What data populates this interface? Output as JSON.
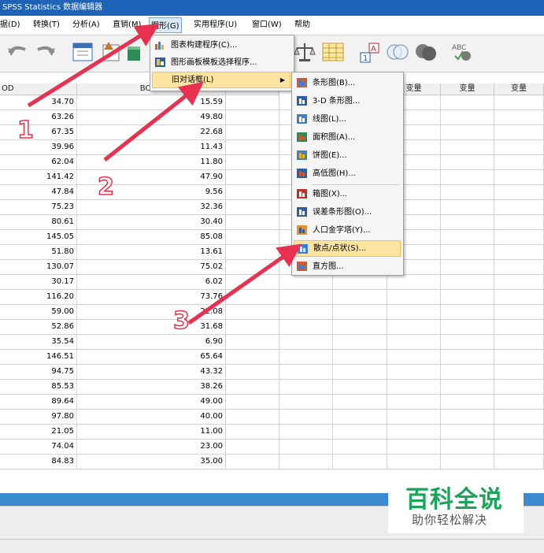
{
  "window": {
    "title": "SPSS Statistics 数据编辑器"
  },
  "menubar": {
    "items": [
      "据(D)",
      "转换(T)",
      "分析(A)",
      "直销(M)",
      "图形(G)",
      "实用程序(U)",
      "窗口(W)",
      "帮助"
    ]
  },
  "grid": {
    "col_headers": [
      "OD",
      "BOD5",
      "变量",
      "变量",
      "变量",
      "变量"
    ],
    "rows": [
      [
        "34.70",
        "15.59"
      ],
      [
        "63.26",
        "49.80"
      ],
      [
        "67.35",
        "22.68"
      ],
      [
        "39.96",
        "11.43"
      ],
      [
        "62.04",
        "11.80"
      ],
      [
        "141.42",
        "47.90"
      ],
      [
        "47.84",
        "9.56"
      ],
      [
        "75.23",
        "32.36"
      ],
      [
        "80.61",
        "30.40"
      ],
      [
        "145.05",
        "85.08"
      ],
      [
        "51.80",
        "13.61"
      ],
      [
        "130.07",
        "75.02"
      ],
      [
        "30.17",
        "6.02"
      ],
      [
        "116.20",
        "73.76"
      ],
      [
        "59.00",
        "22.08"
      ],
      [
        "52.86",
        "31.68"
      ],
      [
        "35.54",
        "6.90"
      ],
      [
        "146.51",
        "65.64"
      ],
      [
        "94.75",
        "43.32"
      ],
      [
        "85.53",
        "38.26"
      ],
      [
        "89.64",
        "49.00"
      ],
      [
        "97.80",
        "40.00"
      ],
      [
        "21.05",
        "11.00"
      ],
      [
        "74.04",
        "23.00"
      ],
      [
        "84.83",
        "35.00"
      ]
    ]
  },
  "graph_menu": {
    "items": [
      {
        "label": "图表构建程序(C)...",
        "icon": "chart-builder-icon"
      },
      {
        "label": "图形画板模板选择程序...",
        "icon": "graphboard-icon"
      },
      {
        "label": "旧对话框(L)",
        "icon": "",
        "submenu": true
      }
    ]
  },
  "legacy_submenu": {
    "items": [
      {
        "label": "条形图(B)...",
        "icon": "bar-chart-icon"
      },
      {
        "label": "3-D 条形图...",
        "icon": "3d-bar-chart-icon"
      },
      {
        "label": "线图(L)...",
        "icon": "line-chart-icon"
      },
      {
        "label": "面积图(A)...",
        "icon": "area-chart-icon"
      },
      {
        "label": "饼图(E)...",
        "icon": "pie-chart-icon"
      },
      {
        "label": "高低图(H)...",
        "icon": "high-low-chart-icon"
      },
      {
        "label": "箱图(X)...",
        "icon": "boxplot-icon"
      },
      {
        "label": "误差条形图(O)...",
        "icon": "error-bar-icon"
      },
      {
        "label": "人口金字塔(Y)...",
        "icon": "population-pyramid-icon"
      },
      {
        "label": "散点/点状(S)...",
        "icon": "scatter-dot-icon"
      },
      {
        "label": "直方图...",
        "icon": "histogram-icon"
      }
    ]
  },
  "annotations": {
    "step1": "1",
    "step2": "2",
    "step3": "3",
    "arrow_color": "#e8314e"
  },
  "watermark": {
    "main": "百科全说",
    "sub": "助你轻松解决"
  }
}
